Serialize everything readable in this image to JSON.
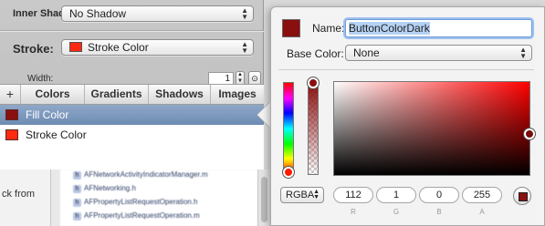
{
  "inspector": {
    "inner_shadow_label": "Inner Shadow:",
    "inner_shadow_value": "No Shadow",
    "stroke_label": "Stroke:",
    "stroke_value": "Stroke Color",
    "width_label": "Width:",
    "width_value": "1",
    "stroke_swatch_color": "#ff2a10"
  },
  "panel": {
    "tabs": [
      "+",
      "Colors",
      "Gradients",
      "Shadows",
      "Images"
    ],
    "colors": [
      {
        "name": "Fill Color",
        "swatch": "#8a0f0f",
        "selected": true
      },
      {
        "name": "Stroke Color",
        "swatch": "#ff2a10",
        "selected": false
      }
    ]
  },
  "background": {
    "fragment": "ck from",
    "files": [
      "AFNetworkActivityIndicatorManager.m",
      "AFNetworking.h",
      "AFPropertyListRequestOperation.h",
      "AFPropertyListRequestOperation.m"
    ]
  },
  "picker": {
    "name_label": "Name:",
    "name_value": "ButtonColorDark",
    "base_label": "Base Color:",
    "base_value": "None",
    "swatch_color": "#8a0f0f",
    "mode": "RGBA",
    "components": [
      {
        "label": "R",
        "value": "112"
      },
      {
        "label": "G",
        "value": "1"
      },
      {
        "label": "B",
        "value": "0"
      },
      {
        "label": "A",
        "value": "255"
      }
    ],
    "accent_color": "#6f9bd6"
  }
}
